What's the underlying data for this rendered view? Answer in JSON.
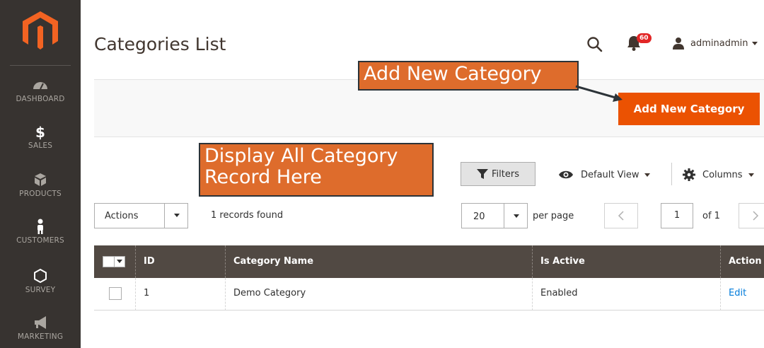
{
  "sidebar": {
    "logo": "magento-logo",
    "items": [
      {
        "label": "DASHBOARD",
        "icon": "dashboard-icon"
      },
      {
        "label": "SALES",
        "icon": "dollar-icon"
      },
      {
        "label": "PRODUCTS",
        "icon": "box-icon"
      },
      {
        "label": "CUSTOMERS",
        "icon": "person-icon"
      },
      {
        "label": "SURVEY",
        "icon": "hexagon-icon"
      },
      {
        "label": "MARKETING",
        "icon": "megaphone-icon"
      }
    ]
  },
  "header": {
    "title": "Categories List",
    "notification_count": "60",
    "username": "adminadmin"
  },
  "action_bar": {
    "add_button_label": "Add New Category"
  },
  "annotations": {
    "add_new": "Add New Category",
    "display_line1": "Display All Category",
    "display_line2": "Record Here"
  },
  "toolbar": {
    "filters_label": "Filters",
    "view_label": "Default View",
    "columns_label": "Columns",
    "actions_label": "Actions",
    "records_found": "1 records found",
    "per_page_value": "20",
    "per_page_label": "per page",
    "current_page": "1",
    "page_of": "of 1"
  },
  "grid": {
    "columns": [
      "ID",
      "Category Name",
      "Is Active",
      "Action"
    ],
    "rows": [
      {
        "id": "1",
        "name": "Demo Category",
        "status": "Enabled",
        "action": "Edit"
      }
    ]
  },
  "colors": {
    "sidebar_bg": "#373330",
    "accent": "#eb5202",
    "annotation_bg": "#de6c2c",
    "grid_header_bg": "#514943",
    "link": "#007bdb"
  }
}
